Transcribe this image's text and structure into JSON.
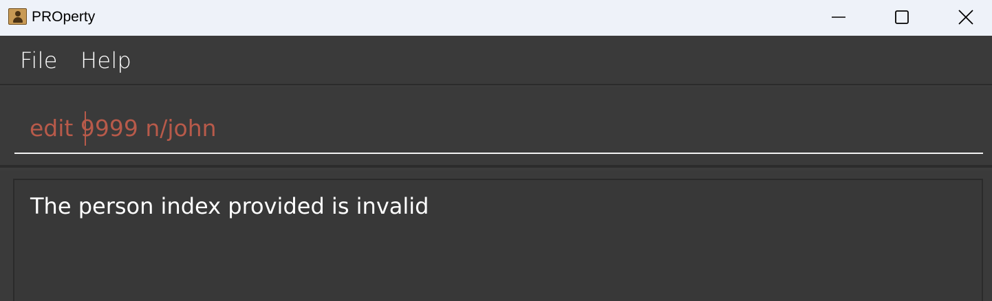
{
  "window": {
    "title": "PROperty",
    "controls": {
      "minimize": "minimize-icon",
      "maximize": "maximize-icon",
      "close": "close-icon"
    }
  },
  "menu": {
    "items": [
      {
        "label": "File"
      },
      {
        "label": "Help"
      }
    ]
  },
  "command_box": {
    "value": "edit 9999 n/john",
    "text_color": "#b85a4a"
  },
  "result_display": {
    "message": "The person index provided is invalid"
  },
  "colors": {
    "background": "#3c3c3c",
    "titlebar": "#eef2f9",
    "error_text": "#b85a4a",
    "text": "#ffffff"
  }
}
